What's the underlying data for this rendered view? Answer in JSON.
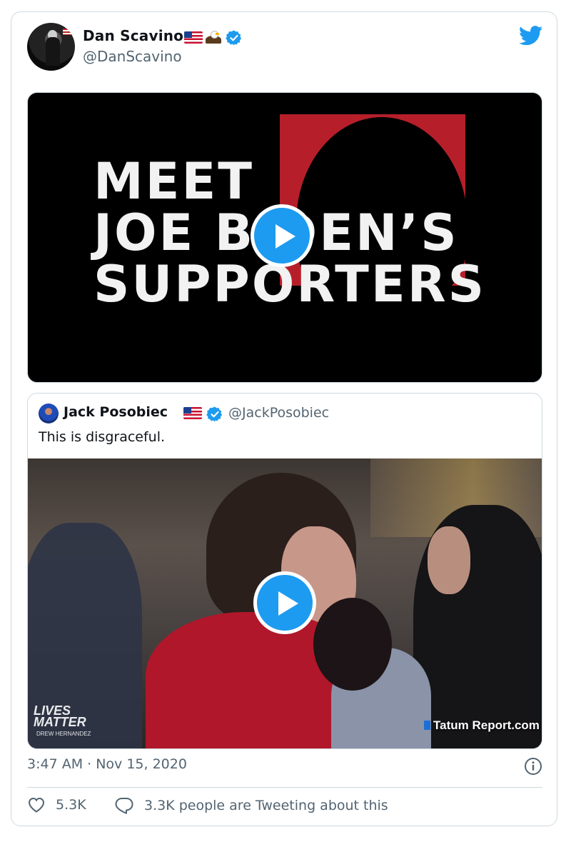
{
  "tweet": {
    "author": {
      "display_name": "Dan Scavino",
      "handle": "@DanScavino",
      "name_emojis": [
        "us-flag",
        "eagle"
      ],
      "verified": true
    },
    "media": {
      "type": "video",
      "headline_lines": [
        "MEET",
        "JOE BIDEN’S",
        "SUPPORTERS"
      ]
    },
    "quoted": {
      "display_name": "Jack Posobiec",
      "handle": "@JackPosobiec",
      "name_emojis": [
        "us-flag"
      ],
      "verified": true,
      "text": "This is disgraceful.",
      "media": {
        "type": "video",
        "watermark_left": [
          "LIVES",
          "MATTER"
        ],
        "watermark_left_sub": "DREW HERNANDEZ",
        "watermark_right": "Tatum Report.com"
      }
    },
    "timestamp": "3:47 AM · Nov 15, 2020",
    "likes": "5.3K",
    "reply_text": "3.3K people are Tweeting about this"
  },
  "colors": {
    "accent": "#1d9bf0",
    "muted_text": "#536471",
    "border": "#cfd9de",
    "headline_red": "#b61f2a"
  }
}
